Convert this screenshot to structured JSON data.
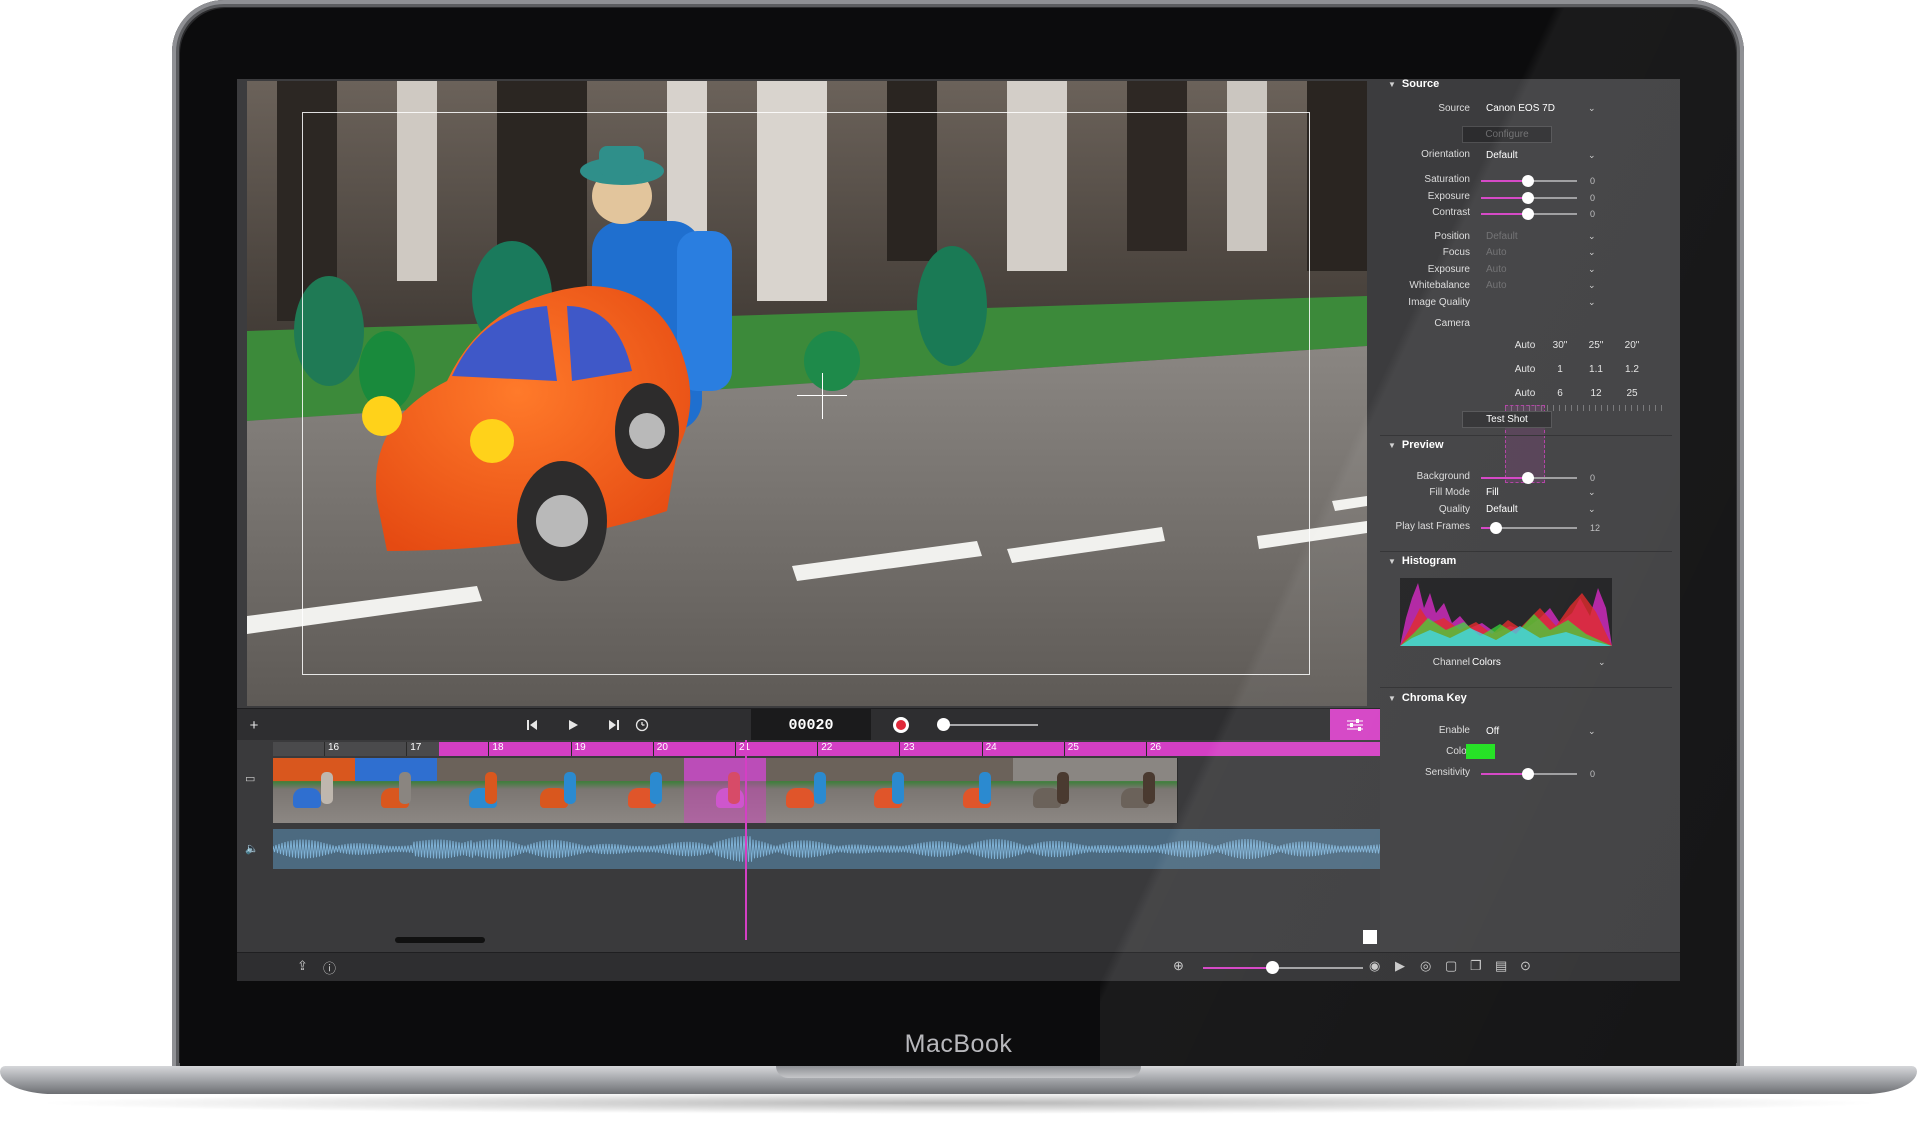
{
  "device": {
    "brand_label": "MacBook"
  },
  "transport": {
    "add_label": "+",
    "frame_counter": "00020"
  },
  "timeline": {
    "frame_numbers": [
      "16",
      "17",
      "18",
      "19",
      "20",
      "21",
      "22",
      "23",
      "24",
      "25",
      "26"
    ],
    "playhead_frame": "20"
  },
  "inspector": {
    "source": {
      "title": "Source",
      "source_label": "Source",
      "source_value": "Canon EOS 7D",
      "configure_button": "Configure",
      "orientation_label": "Orientation",
      "orientation_value": "Default",
      "saturation_label": "Saturation",
      "saturation_value": "0",
      "exposure_label": "Exposure",
      "exposure_value": "0",
      "contrast_label": "Contrast",
      "contrast_value": "0",
      "position_label": "Position",
      "position_value": "Default",
      "focus_label": "Focus",
      "focus_value": "Auto",
      "exposure2_label": "Exposure",
      "exposure2_value": "Auto",
      "whitebalance_label": "Whitebalance",
      "whitebalance_value": "Auto",
      "image_quality_label": "Image Quality",
      "camera_label": "Camera",
      "camera_rows": [
        [
          "Auto",
          "30\"",
          "25\"",
          "20\""
        ],
        [
          "Auto",
          "1",
          "1.1",
          "1.2"
        ],
        [
          "Auto",
          "6",
          "12",
          "25"
        ]
      ],
      "test_shot_button": "Test Shot"
    },
    "preview": {
      "title": "Preview",
      "background_label": "Background",
      "background_value": "0",
      "fill_mode_label": "Fill Mode",
      "fill_mode_value": "Fill",
      "quality_label": "Quality",
      "quality_value": "Default",
      "play_last_frames_label": "Play last Frames",
      "play_last_frames_value": "12"
    },
    "histogram": {
      "title": "Histogram",
      "channel_label": "Channel",
      "channel_value": "Colors"
    },
    "chroma_key": {
      "title": "Chroma Key",
      "enable_label": "Enable",
      "enable_value": "Off",
      "color_label": "Color",
      "sensitivity_label": "Sensitivity",
      "sensitivity_value": "0"
    }
  },
  "colors": {
    "accent": "#d43fc4",
    "chroma_key_color": "#1be01b",
    "record": "#e0293a",
    "waveform": "#7fb2d6"
  },
  "icons": {
    "skip_back": "skip-back-icon",
    "play": "play-icon",
    "skip_forward": "skip-forward-icon",
    "timer": "timer-icon",
    "record": "record-icon",
    "timeline_settings": "sliders-icon",
    "share": "share-icon",
    "help": "help-icon",
    "zoom": "zoom-icon"
  }
}
